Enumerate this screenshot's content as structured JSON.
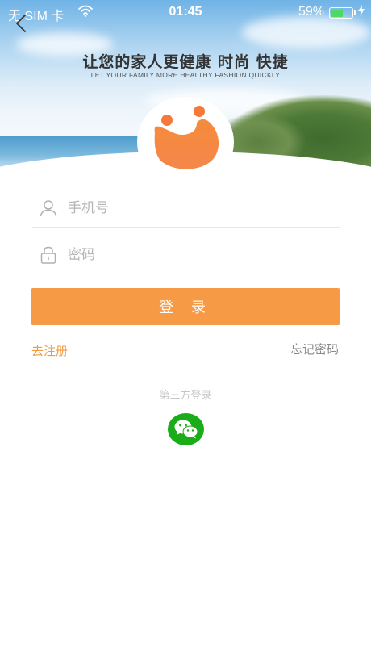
{
  "status_bar": {
    "carrier": "无 SIM 卡",
    "wifi_icon": "wifi-icon",
    "time": "01:45",
    "battery_percent": "59%",
    "battery_level": 0.59,
    "charging_icon": "charging-bolt-icon"
  },
  "header": {
    "back_icon": "chevron-left-icon",
    "slogan_cn": "让您的家人更健康  时尚  快捷",
    "slogan_en": "LET YOUR FAMILY MORE HEALTHY FASHION QUICKLY",
    "logo_icon": "app-logo-icon"
  },
  "form": {
    "phone": {
      "icon": "user-icon",
      "placeholder": "手机号",
      "value": ""
    },
    "password": {
      "icon": "lock-icon",
      "placeholder": "密码",
      "value": ""
    },
    "login_label": "登 录",
    "register_label": "去注册",
    "forgot_label": "忘记密码"
  },
  "third_party": {
    "label": "第三方登录",
    "wechat_icon": "wechat-icon"
  },
  "colors": {
    "accent": "#f69a45",
    "register_link": "#f09a3e",
    "wechat": "#1aad19",
    "battery": "#4cd964"
  }
}
